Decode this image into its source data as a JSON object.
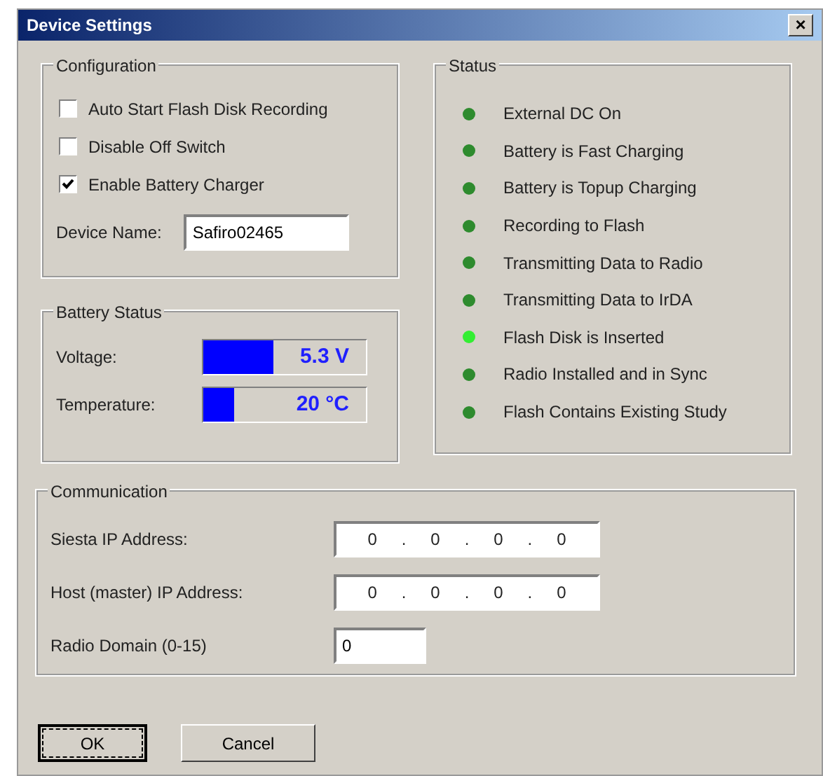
{
  "window": {
    "title": "Device Settings",
    "close": "×"
  },
  "configuration": {
    "title": "Configuration",
    "checkboxes": [
      {
        "label": "Auto Start Flash Disk Recording",
        "checked": false
      },
      {
        "label": "Disable Off Switch",
        "checked": false
      },
      {
        "label": "Enable Battery Charger",
        "checked": true
      }
    ],
    "device_name": {
      "label": "Device Name:",
      "value": "Safiro02465"
    }
  },
  "battery_status": {
    "title": "Battery Status",
    "meters": [
      {
        "label": "Voltage:",
        "level": 0.43,
        "reading": "5.3 V"
      },
      {
        "label": "Temperature:",
        "level": 0.19,
        "reading": "20 °C"
      }
    ]
  },
  "status": {
    "title": "Status",
    "items": [
      {
        "label": "External DC On",
        "color": "#2e8b2e"
      },
      {
        "label": "Battery is Fast Charging",
        "color": "#2e8b2e"
      },
      {
        "label": "Battery is Topup Charging",
        "color": "#2e8b2e"
      },
      {
        "label": "Recording to Flash",
        "color": "#2e8b2e"
      },
      {
        "label": "Transmitting Data to Radio",
        "color": "#2e8b2e"
      },
      {
        "label": "Transmitting Data to IrDA",
        "color": "#2e8b2e"
      },
      {
        "label": "Flash Disk is Inserted",
        "color": "#33ee33"
      },
      {
        "label": "Radio Installed and in Sync",
        "color": "#2e8b2e"
      },
      {
        "label": "Flash Contains Existing Study",
        "color": "#2e8b2e"
      }
    ]
  },
  "communication": {
    "title": "Communication",
    "fields": [
      {
        "kind": "ip",
        "label": "Siesta IP Address:",
        "octets": [
          "0",
          "0",
          "0",
          "0"
        ],
        "separator": "."
      },
      {
        "kind": "ip",
        "label": "Host (master) IP Address:",
        "octets": [
          "0",
          "0",
          "0",
          "0"
        ],
        "separator": "."
      },
      {
        "kind": "text",
        "label": "Radio Domain (0-15)",
        "value": "0"
      }
    ]
  },
  "buttons": [
    {
      "label": "OK",
      "focused": true
    },
    {
      "label": "Cancel",
      "focused": false
    }
  ]
}
